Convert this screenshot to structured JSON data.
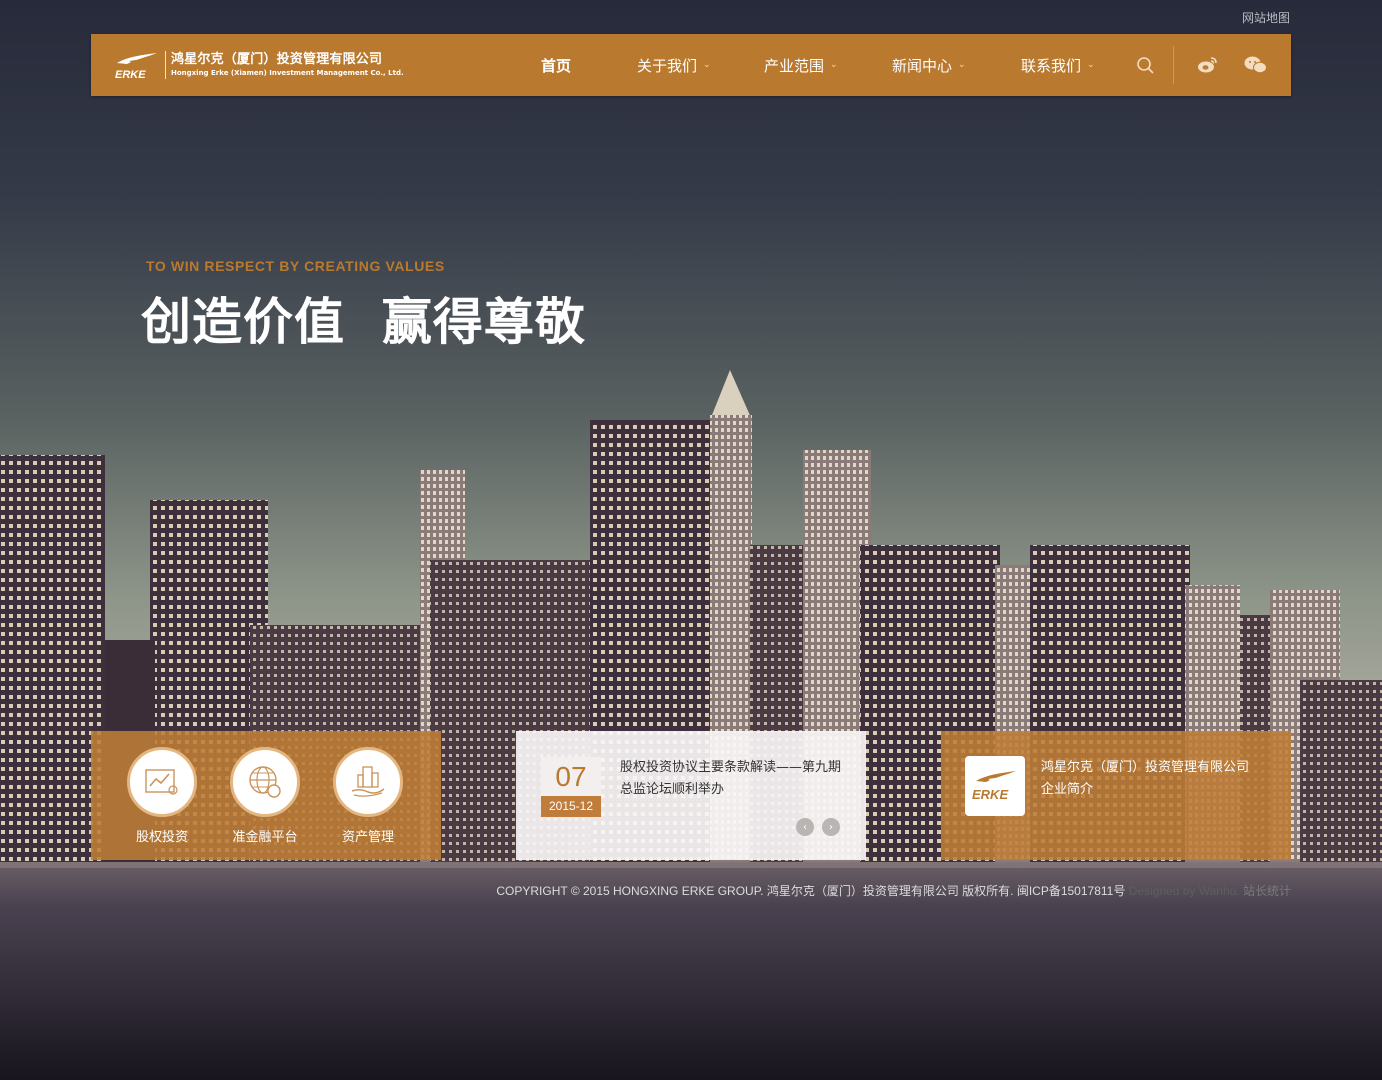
{
  "topbar": {
    "sitemap_label": "网站地图"
  },
  "brand": {
    "logo_mark_text": "ERKE",
    "company_cn": "鸿星尔克（厦门）投资管理有限公司",
    "company_en": "Hongxing Erke (Xiamen) Investment Management Co., Ltd.",
    "accent_color": "#b9792f"
  },
  "nav": {
    "items": [
      {
        "label": "首页",
        "has_dropdown": false,
        "active": true
      },
      {
        "label": "关于我们",
        "has_dropdown": true
      },
      {
        "label": "产业范围",
        "has_dropdown": true
      },
      {
        "label": "新闻中心",
        "has_dropdown": true
      },
      {
        "label": "联系我们",
        "has_dropdown": true
      }
    ],
    "icons": [
      "search-icon",
      "weibo-icon",
      "wechat-icon"
    ]
  },
  "hero": {
    "subtitle": "TO WIN RESPECT BY CREATING VALUES",
    "title": "创造价值  赢得尊敬"
  },
  "services": [
    {
      "label": "股权投资",
      "icon": "chart-trend-icon"
    },
    {
      "label": "准金融平台",
      "icon": "globe-coin-icon"
    },
    {
      "label": "资产管理",
      "icon": "building-hand-icon"
    }
  ],
  "news": {
    "day": "07",
    "month": "2015-12",
    "title": "股权投资协议主要条款解读——第九期总监论坛顺利举办",
    "prev_icon": "chevron-left-icon",
    "next_icon": "chevron-right-icon"
  },
  "about": {
    "logo_text": "ERKE",
    "text": "鸿星尔克（厦门）投资管理有限公司企业简介"
  },
  "footer": {
    "copyright": "COPYRIGHT © 2015 HONGXING ERKE GROUP. 鸿星尔克（厦门）投资管理有限公司 版权所有.   闽ICP备15017811号",
    "designed_by": "Designed by Wanhu.",
    "stats": "站长统计"
  }
}
